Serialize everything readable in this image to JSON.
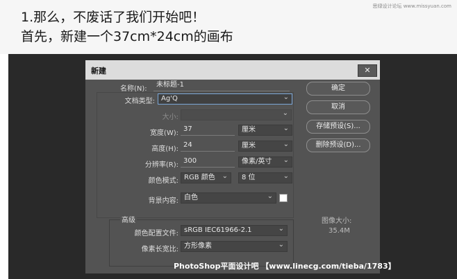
{
  "page": {
    "watermark": "思绿设计论坛 www.missyuan.com",
    "heading_line1": "1.那么，不废话了我们开始吧！",
    "heading_line2": "首先，新建一个37cm*24cm的画布",
    "bottom_banner": "PhotoShop平面设计吧 【www.linecg.com/tieba/1783】"
  },
  "dialog": {
    "title": "新建",
    "close": "✕",
    "name_label": "名称(N):",
    "name_value": "未标题-1",
    "doc_type_label": "文档类型:",
    "doc_type_value": "Ag'Q",
    "size_label": "大小:",
    "width_label": "宽度(W):",
    "width_value": "37",
    "width_unit": "厘米",
    "height_label": "高度(H):",
    "height_value": "24",
    "height_unit": "厘米",
    "resolution_label": "分辨率(R):",
    "resolution_value": "300",
    "resolution_unit": "像素/英寸",
    "color_mode_label": "颜色模式:",
    "color_mode_value": "RGB 颜色",
    "bit_depth_value": "8 位",
    "background_label": "背景内容:",
    "background_value": "白色",
    "background_color": "#ffffff",
    "advanced_label": "高级",
    "color_profile_label": "颜色配置文件:",
    "color_profile_value": "sRGB IEC61966-2.1",
    "pixel_aspect_label": "像素长宽比:",
    "pixel_aspect_value": "方形像素",
    "image_size_label": "图像大小:",
    "image_size_value": "35.4M",
    "buttons": {
      "ok": "确定",
      "cancel": "取消",
      "save_preset": "存储预设(S)...",
      "delete_preset": "删除预设(D)..."
    }
  }
}
